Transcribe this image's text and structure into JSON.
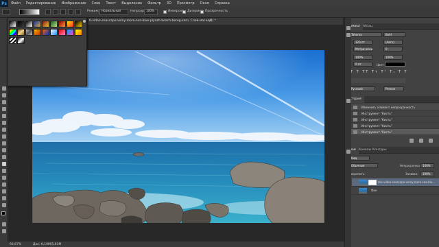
{
  "menubar": {
    "logo": "Ps",
    "items": [
      "Файл",
      "Редактирование",
      "Изображение",
      "Слои",
      "Текст",
      "Выделение",
      "Фильтр",
      "3D",
      "Просмотр",
      "Окно",
      "Справка"
    ]
  },
  "options_bar": {
    "mode_label": "Режим:",
    "mode_value": "Нормальный",
    "opacity_label": "Непрозр.:",
    "opacity_value": "100%",
    "inversion": "Инверсия",
    "dither": "Дизеринг",
    "transparency": "Прозрачность"
  },
  "document": {
    "tab_label": "б-video-seascape-volny-more-sea-blue-plyazh-beach-bereg-kam, Слой-маска/8) *",
    "close": "×"
  },
  "status": {
    "zoom": "66,67%",
    "doc_size": "Док: 6,10М/5,61М"
  },
  "right": {
    "tabs_top": [
      "Символ",
      "Абзац"
    ],
    "char": {
      "font": "Tahoma",
      "style": "Bold",
      "size": "120 пт",
      "leading": "(Авто)",
      "kerning": "Метрически",
      "tracking": "0",
      "vscale": "100%",
      "hscale": "100%",
      "baseline": "0 пт",
      "color_label": "Цвет:",
      "language": "Русский",
      "aa": "Резкое",
      "style_buttons": [
        "T",
        "T",
        "TT",
        "Tт",
        "T¹",
        "T₁",
        "T",
        "T"
      ]
    },
    "history_title": "История",
    "history": [
      "Изменить элемент непрозрачность",
      "Инструмент \"Кисть\"",
      "Инструмент \"Кисть\"",
      "Инструмент \"Кисть\"",
      "Инструмент \"Кисть\""
    ],
    "layers_tabs": [
      "Слои",
      "Каналы",
      "Контуры"
    ],
    "layers": {
      "filter": "Вид",
      "blend": "Обычные",
      "opacity_label": "Непрозрачность:",
      "opacity": "100%",
      "lock_label": "Закрепить:",
      "fill_label": "Заливка:",
      "fill": "100%",
      "items": [
        {
          "name": "zko-video-seascape-volny-more-sea-blu...",
          "visible": true
        },
        {
          "name": "Фон",
          "visible": true
        }
      ]
    }
  }
}
